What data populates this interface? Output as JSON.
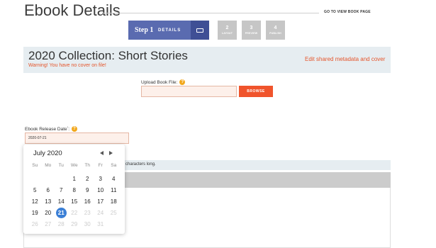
{
  "header": {
    "title": "Ebook Details",
    "view_link": "GO TO VIEW BOOK PAGE"
  },
  "steps": {
    "active": {
      "label": "Step 1",
      "name": "DETAILS",
      "icon": "keyboard-icon"
    },
    "others": [
      {
        "num": "2",
        "label": "LAYOUT"
      },
      {
        "num": "3",
        "label": "PREVIEW"
      },
      {
        "num": "4",
        "label": "PUBLISH"
      }
    ]
  },
  "collection": {
    "title": "2020 Collection: Short Stories",
    "warning": "Warning! You have no cover on file!",
    "edit_link": "Edit shared metadata and cover"
  },
  "upload": {
    "label": "Upload Book File:",
    "value": "",
    "button": "BROWSE"
  },
  "release": {
    "label": "Ebook Release Date",
    "required_mark": "*",
    "colon": ":",
    "value": "2020-07-21"
  },
  "info_bar": {
    "text": "0 characters long."
  },
  "datepicker": {
    "month": "July 2020",
    "weekdays": [
      "Su",
      "Mo",
      "Tu",
      "We",
      "Th",
      "Fr",
      "Sa"
    ],
    "weeks": [
      [
        "",
        "",
        "",
        "1",
        "2",
        "3",
        "4"
      ],
      [
        "5",
        "6",
        "7",
        "8",
        "9",
        "10",
        "11"
      ],
      [
        "12",
        "13",
        "14",
        "15",
        "16",
        "17",
        "18"
      ],
      [
        "19",
        "20",
        "21",
        "22",
        "23",
        "24",
        "25"
      ],
      [
        "26",
        "27",
        "28",
        "29",
        "30",
        "31",
        ""
      ]
    ],
    "selected": "21",
    "last_enabled": "21"
  },
  "colors": {
    "accent": "#5a6bb0",
    "warning": "#e5552b",
    "button": "#f0542c",
    "selected_day": "#3b7fd6",
    "help_icon": "#f2a81d"
  }
}
